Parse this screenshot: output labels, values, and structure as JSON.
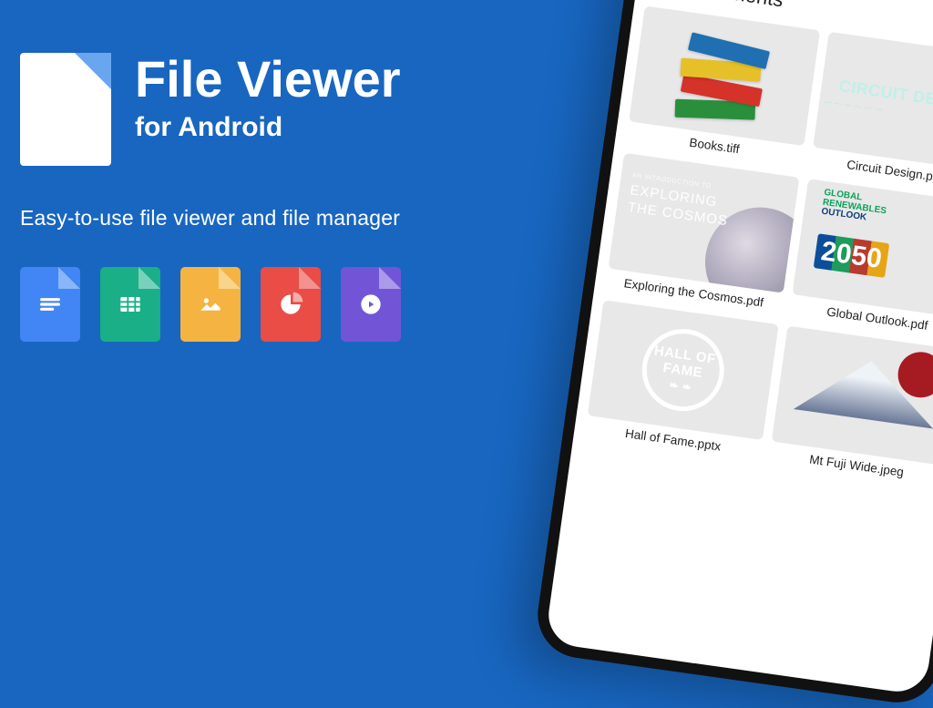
{
  "promo": {
    "title": "File Viewer",
    "subtitle": "for Android",
    "tagline": "Easy-to-use file viewer and file manager",
    "type_icons": [
      "doc",
      "sheet",
      "image",
      "presentation",
      "media"
    ]
  },
  "phone": {
    "appbar_title": "Documents",
    "files": [
      {
        "name": "Books.tiff",
        "thumbnail": "books",
        "thumb_text": ""
      },
      {
        "name": "Circuit Design.pptx",
        "thumbnail": "circuit",
        "thumb_text": "CIRCUIT DESIGN"
      },
      {
        "name": "Exploring the Cosmos.pdf",
        "thumbnail": "cosmos",
        "thumb_kicker": "AN INTRODUCTION TO",
        "thumb_text": "EXPLORING\nTHE COSMOS"
      },
      {
        "name": "Global Outlook.pdf",
        "thumbnail": "global",
        "thumb_head1": "GLOBAL",
        "thumb_head2": "RENEWABLES",
        "thumb_head3": "OUTLOOK",
        "thumb_year": "2050"
      },
      {
        "name": "Hall of Fame.pptx",
        "thumbnail": "hall",
        "thumb_line1": "HALL OF",
        "thumb_line2": "FAME"
      },
      {
        "name": "Mt Fuji Wide.jpeg",
        "thumbnail": "fuji",
        "thumb_text": ""
      }
    ]
  }
}
